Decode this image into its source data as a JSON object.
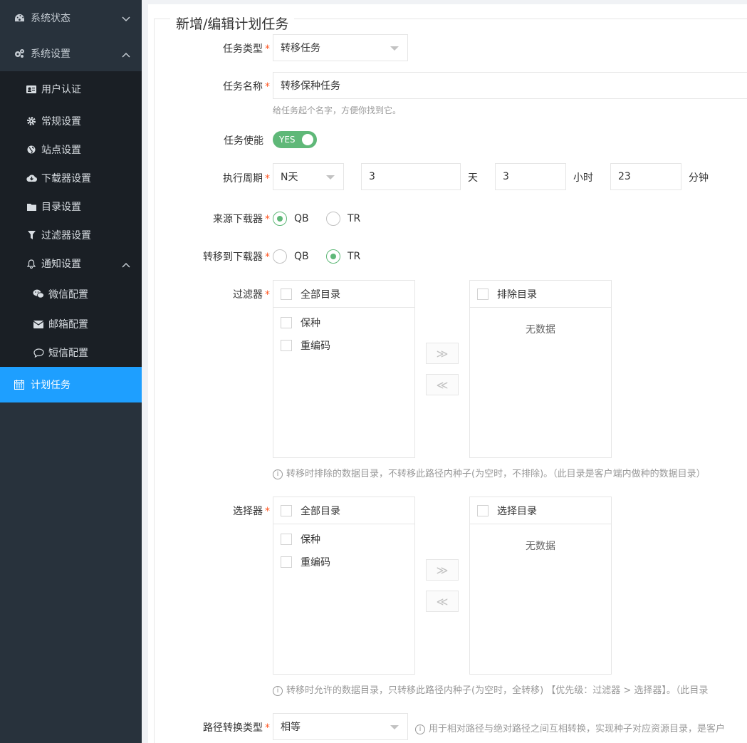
{
  "sidebar": {
    "status_label": "系统状态",
    "settings_label": "系统设置",
    "sub_items": [
      {
        "label": "用户认证"
      },
      {
        "label": "常规设置"
      },
      {
        "label": "站点设置"
      },
      {
        "label": "下载器设置"
      },
      {
        "label": "目录设置"
      },
      {
        "label": "过滤器设置"
      },
      {
        "label": "通知设置"
      }
    ],
    "notify_items": [
      {
        "label": "微信配置"
      },
      {
        "label": "邮箱配置"
      },
      {
        "label": "短信配置"
      }
    ],
    "active_label": "计划任务"
  },
  "form": {
    "legend": "新增/编辑计划任务",
    "required_mark": "*",
    "task_type": {
      "label": "任务类型",
      "value": "转移任务"
    },
    "task_name": {
      "label": "任务名称",
      "value": "转移保种任务",
      "hint": "给任务起个名字，方便你找到它。"
    },
    "task_enable": {
      "label": "任务使能",
      "switch_text": "YES"
    },
    "period": {
      "label": "执行周期",
      "mode": "N天",
      "days": "3",
      "days_unit": "天",
      "hours": "3",
      "hours_unit": "小时",
      "minutes": "23",
      "minutes_unit": "分钟"
    },
    "source_downloader": {
      "label": "来源下载器",
      "options": [
        "QB",
        "TR"
      ],
      "selected": "QB"
    },
    "target_downloader": {
      "label": "转移到下载器",
      "options": [
        "QB",
        "TR"
      ],
      "selected": "TR"
    },
    "filter": {
      "label": "过滤器",
      "left_title": "全部目录",
      "left_items": [
        "保种",
        "重编码"
      ],
      "right_title": "排除目录",
      "right_empty": "无数据",
      "desc": "转移时排除的数据目录，不转移此路径内种子(为空时，不排除)。（此目录是客户端内做种的数据目录）"
    },
    "selector": {
      "label": "选择器",
      "left_title": "全部目录",
      "left_items": [
        "保种",
        "重编码"
      ],
      "right_title": "选择目录",
      "right_empty": "无数据",
      "desc": "转移时允许的数据目录，只转移此路径内种子(为空时，全转移) 【优先级：过滤器 > 选择器】。（此目录"
    },
    "path_convert": {
      "label": "路径转换类型",
      "value": "相等",
      "desc": "用于相对路径与绝对路径之间互相转换，实现种子对应资源目录，是客户"
    },
    "transfer_right": "≫",
    "transfer_left": "≪",
    "info_glyph": "i"
  }
}
